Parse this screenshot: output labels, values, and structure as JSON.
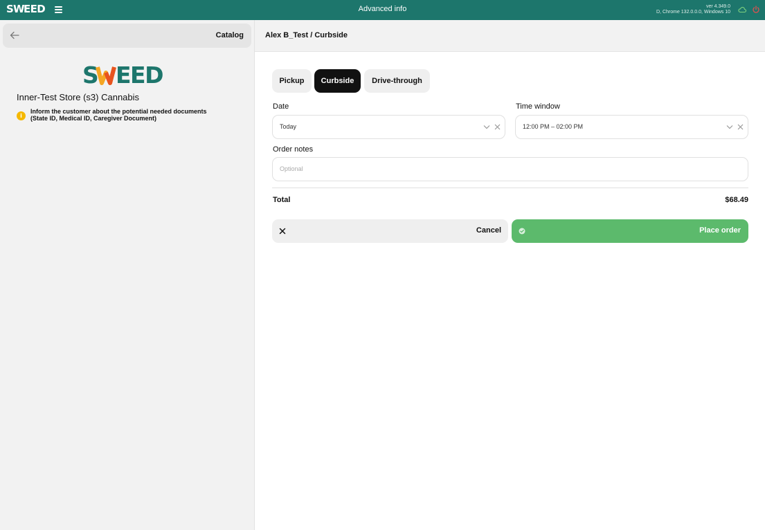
{
  "topbar": {
    "logo_text": "SWEED",
    "title": "Advanced info",
    "version_line1": "ver 4.349.0",
    "version_line2": "D, Chrome 132.0.0.0, Windows 10",
    "icons": [
      "menu-icon",
      "cloud-icon",
      "power-icon"
    ]
  },
  "sidebar": {
    "back_label": "",
    "catalog_label": "Catalog",
    "logo_text": "SWEED",
    "store_name": "Inner-Test Store (s3) Cannabis",
    "notice_line1": "Inform the customer about the potential needed documents",
    "notice_line2": "(State ID, Medical ID, Caregiver Document)",
    "notice_icon_glyph": "i"
  },
  "main": {
    "breadcrumb": "Alex B_Test / Curbside",
    "tabs": [
      {
        "label": "Pickup",
        "active": false
      },
      {
        "label": "Curbside",
        "active": true
      },
      {
        "label": "Drive-through",
        "active": false
      }
    ],
    "date": {
      "label": "Date",
      "value": "Today"
    },
    "time_window": {
      "label": "Time window",
      "value": "12:00 PM – 02:00 PM"
    },
    "order_notes": {
      "label": "Order notes",
      "placeholder": "Optional"
    },
    "total_label": "Total",
    "total_value": "$68.49",
    "cancel_label": "Cancel",
    "place_order_label": "Place order"
  },
  "colors": {
    "brand_teal": "#1d766c",
    "logo_orange": "#f5a623",
    "accent_green": "#5cba6c",
    "warning_yellow": "#f5b800",
    "active_tab": "#111111",
    "power_red": "#e05050"
  }
}
